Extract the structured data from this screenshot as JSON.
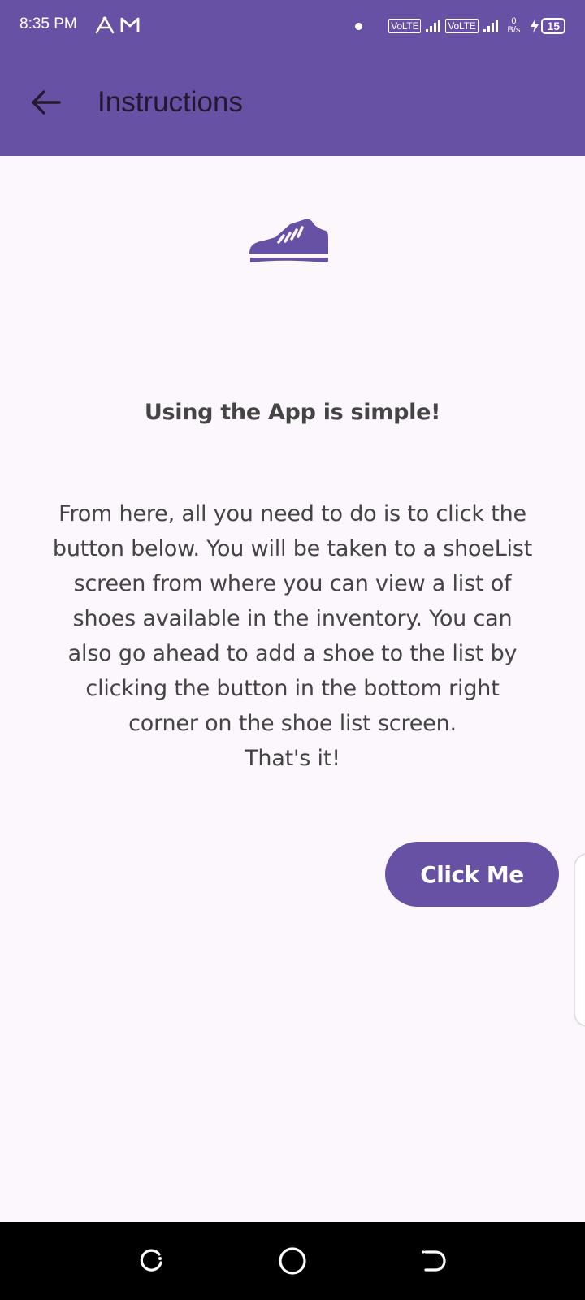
{
  "status_bar": {
    "time": "8:35 PM",
    "network_labels": [
      "VoLTE",
      "VoLTE"
    ],
    "net_speed_value": "0",
    "net_speed_unit": "B/s",
    "battery_level": "15",
    "notification_icons": [
      "a-icon",
      "gmail-icon"
    ]
  },
  "app_bar": {
    "title": "Instructions"
  },
  "content": {
    "heading": "Using the App is simple!",
    "body": "From here, all you need to do is to click the button below. You will be taken to a shoeList screen from where you can view a list of shoes available in the inventory. You can also go ahead to add a shoe to the list by clicking the button in the bottom right corner on the shoe list screen.\nThat's it!",
    "button_label": "Click Me"
  },
  "colors": {
    "primary": "#6751A4",
    "background": "#FCF7FC",
    "text": "#444444"
  }
}
